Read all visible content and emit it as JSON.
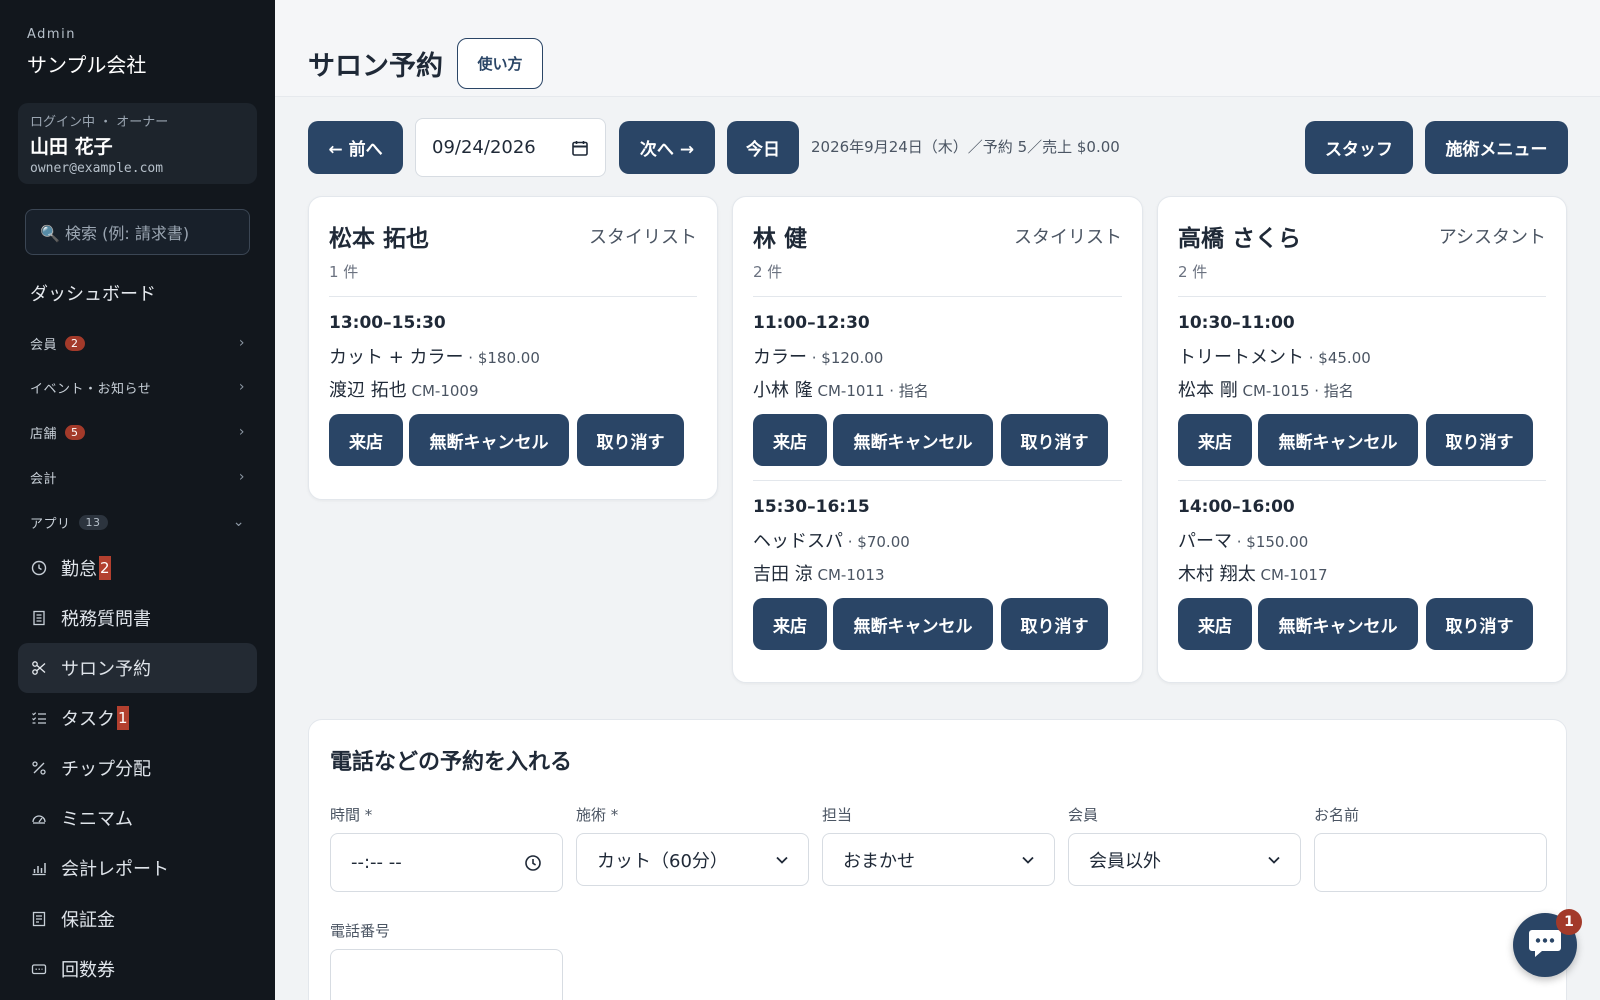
{
  "sidebar": {
    "brand_sub": "Admin",
    "brand_name": "サンプル会社",
    "user_role": "ログイン中 ・ オーナー",
    "user_name": "山田 花子",
    "user_email": "owner@example.com",
    "search_placeholder": "🔍 検索 (例: 請求書)",
    "dashboard": "ダッシュボード",
    "groups": [
      {
        "label": "会員",
        "badge": "2"
      },
      {
        "label": "イベント・お知らせ",
        "badge": ""
      },
      {
        "label": "店舗",
        "badge": "5"
      },
      {
        "label": "会計",
        "badge": ""
      },
      {
        "label": "アプリ",
        "badge": "13"
      }
    ],
    "items": [
      {
        "label": "勤怠",
        "count": "2",
        "icon": "clock-icon"
      },
      {
        "label": "税務質問書",
        "count": "",
        "icon": "document-icon"
      },
      {
        "label": "サロン予約",
        "count": "",
        "icon": "scissors-icon"
      },
      {
        "label": "タスク",
        "count": "1",
        "icon": "checklist-icon"
      },
      {
        "label": "チップ分配",
        "count": "",
        "icon": "percent-icon"
      },
      {
        "label": "ミニマム",
        "count": "",
        "icon": "gauge-icon"
      },
      {
        "label": "会計レポート",
        "count": "",
        "icon": "chart-icon"
      },
      {
        "label": "保証金",
        "count": "",
        "icon": "receipt-icon"
      },
      {
        "label": "回数券",
        "count": "",
        "icon": "ticket-icon"
      }
    ]
  },
  "header": {
    "title": "サロン予約",
    "howto": "使い方"
  },
  "toolbar": {
    "prev": "← 前へ",
    "date_value": "09/24/2026",
    "next": "次へ →",
    "today": "今日",
    "summary": "2026年9月24日（木）／予約 5／売上 $0.00",
    "staff": "スタッフ",
    "menu": "施術メニュー"
  },
  "buttons": {
    "visit": "来店",
    "noshow": "無断キャンセル",
    "cancel": "取り消す"
  },
  "staff_cards": [
    {
      "name": "松本 拓也",
      "role": "スタイリスト",
      "count": "1 件",
      "appointments": [
        {
          "time": "13:00–15:30",
          "service": "カット + カラー",
          "price": " · $180.00",
          "customer": "渡辺 拓也",
          "meta": " CM-1009"
        }
      ]
    },
    {
      "name": "林 健",
      "role": "スタイリスト",
      "count": "2 件",
      "appointments": [
        {
          "time": "11:00–12:30",
          "service": "カラー",
          "price": " · $120.00",
          "customer": "小林 隆",
          "meta": " CM-1011 · 指名"
        },
        {
          "time": "15:30–16:15",
          "service": "ヘッドスパ",
          "price": " · $70.00",
          "customer": "吉田 涼",
          "meta": " CM-1013"
        }
      ]
    },
    {
      "name": "高橋 さくら",
      "role": "アシスタント",
      "count": "2 件",
      "appointments": [
        {
          "time": "10:30–11:00",
          "service": "トリートメント",
          "price": " · $45.00",
          "customer": "松本 剛",
          "meta": " CM-1015 · 指名"
        },
        {
          "time": "14:00–16:00",
          "service": "パーマ",
          "price": " · $150.00",
          "customer": "木村 翔太",
          "meta": " CM-1017"
        }
      ]
    }
  ],
  "form": {
    "title": "電話などの予約を入れる",
    "time_label": "時間 *",
    "time_value": "--:-- --",
    "service_label": "施術 *",
    "service_value": "カット（60分）",
    "staff_label": "担当",
    "staff_value": "おまかせ",
    "member_label": "会員",
    "member_value": "会員以外",
    "name_label": "お名前",
    "name_value": "",
    "phone_label": "電話番号",
    "phone_value": ""
  },
  "chat": {
    "badge": "1"
  }
}
